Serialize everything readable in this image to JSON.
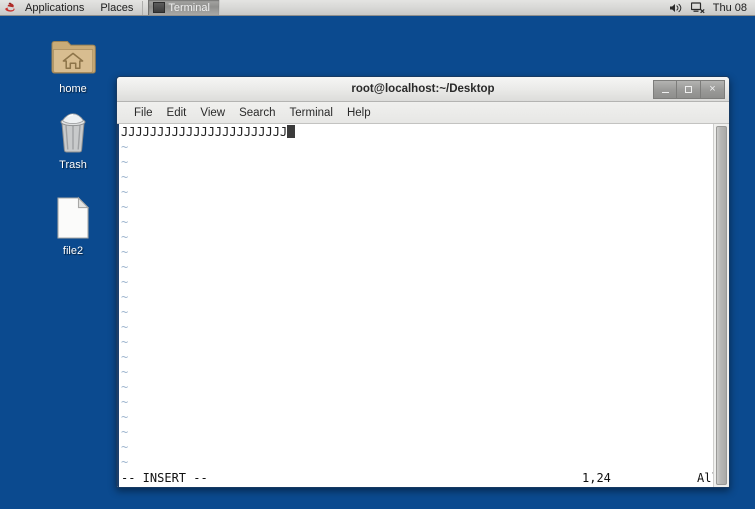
{
  "panel": {
    "logo_icon": "redhat-logo-icon",
    "menus": [
      {
        "label": "Applications"
      },
      {
        "label": "Places"
      }
    ],
    "taskbar": [
      {
        "label": "Terminal",
        "icon": "terminal-window-icon",
        "active": true
      }
    ],
    "tray": [
      {
        "name": "volume-icon",
        "glyph": "◂))"
      },
      {
        "name": "network-display-icon",
        "glyph": "☲"
      }
    ],
    "clock": "Thu 08"
  },
  "desktop": {
    "background_color": "#0b4a8f",
    "icons": [
      {
        "name": "home",
        "label": "home",
        "icon": "home-folder-icon"
      },
      {
        "name": "trash",
        "label": "Trash",
        "icon": "trash-can-icon"
      },
      {
        "name": "file2",
        "label": "file2",
        "icon": "document-file-icon"
      }
    ]
  },
  "terminal": {
    "title": "root@localhost:~/Desktop",
    "window_buttons": {
      "minimize": "_",
      "maximize": "□",
      "close": "×"
    },
    "menu": [
      {
        "label": "File"
      },
      {
        "label": "Edit"
      },
      {
        "label": "View"
      },
      {
        "label": "Search"
      },
      {
        "label": "Terminal"
      },
      {
        "label": "Help"
      }
    ],
    "content": {
      "first_line": "JJJJJJJJJJJJJJJJJJJJJJJ",
      "empty_marker": "~",
      "empty_line_count": 22
    },
    "status": {
      "mode": "-- INSERT --",
      "position": "1,24",
      "scroll": "All"
    }
  }
}
